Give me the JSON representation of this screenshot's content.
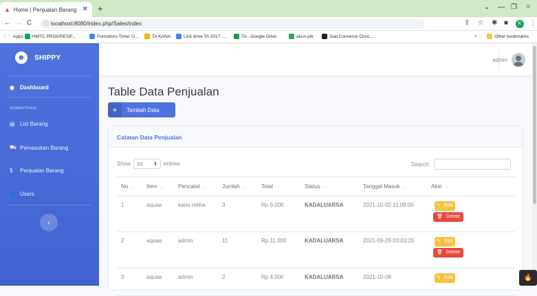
{
  "browser": {
    "tab_title": "Home | Penjualan Barang",
    "url": "localhost:8080/index.php/Sales/index",
    "bookmarks": [
      {
        "label": "Apps",
        "color": "#ffffff"
      },
      {
        "label": "HMTC PROGRESIF...",
        "color": "#1aa260"
      },
      {
        "label": "Pomodoro Timer O...",
        "color": "#4285f4"
      },
      {
        "label": "TA KANA",
        "color": "#f4b400"
      },
      {
        "label": "Link drive TA 2017 -...",
        "color": "#4285f4"
      },
      {
        "label": "TA - Google Drive",
        "color": "#0f9d58"
      },
      {
        "label": "akun-pik",
        "color": "#34a853"
      },
      {
        "label": "Jual Converse Chuc...",
        "color": "#222222"
      }
    ],
    "other_bookmarks": "Other bookmarks"
  },
  "sidebar": {
    "brand": "SHIPPY",
    "dashboard": "Dashboard",
    "section": "ADMINITRASI",
    "items": [
      "List Barang",
      "Pemasukan Barang",
      "Penjualan Barang",
      "Users"
    ]
  },
  "topbar": {
    "user": "admin"
  },
  "page": {
    "title": "Table Data Penjualan",
    "add_button": "Tambah Data",
    "card_title": "Catatan Data Penjualan",
    "show_label": "Show",
    "show_value": "10",
    "entries_label": "entries",
    "search_label": "Search:"
  },
  "table": {
    "headers": [
      "No",
      "Item",
      "Pencatat",
      "Jumlah",
      "Total",
      "Status",
      "Tanggal Masuk",
      "Aksi"
    ],
    "rows": [
      {
        "no": "1",
        "item": "aquaa",
        "pencatat": "kana rekha",
        "jumlah": "3",
        "total": "Rp 9.000",
        "status": "KADALUARSA",
        "tanggal": "2021-10-02 11:08:00"
      },
      {
        "no": "2",
        "item": "aquaa",
        "pencatat": "admin",
        "jumlah": "11",
        "total": "Rp 11.000",
        "status": "KADALUARSA",
        "tanggal": "2021-09-29 03:03:25"
      },
      {
        "no": "3",
        "item": "aquaa",
        "pencatat": "admin",
        "jumlah": "2",
        "total": "Rp 4.000",
        "status": "KADALUARSA",
        "tanggal": "2021-10-08"
      }
    ],
    "edit_label": "Edit",
    "delete_label": "Delete"
  }
}
